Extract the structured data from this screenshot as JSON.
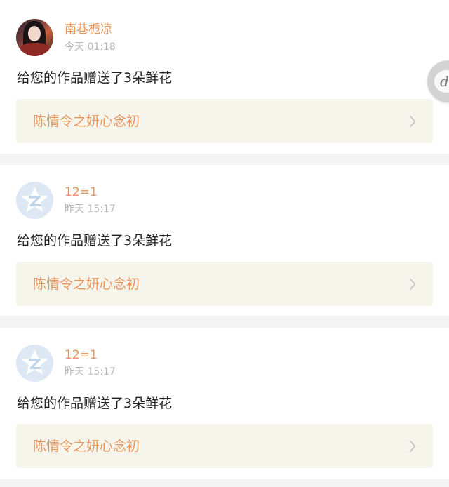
{
  "notifications": [
    {
      "username": "南巷栀凉",
      "timestamp": "今天 01:18",
      "message": "给您的作品赠送了3朵鲜花",
      "work_title": "陈情令之妍心念初",
      "avatar": "photo-avatar"
    },
    {
      "username": "12=1",
      "timestamp": "昨天 15:17",
      "message": "给您的作品赠送了3朵鲜花",
      "work_title": "陈情令之妍心念初",
      "avatar": "default-avatar"
    },
    {
      "username": "12=1",
      "timestamp": "昨天 15:17",
      "message": "给您的作品赠送了3朵鲜花",
      "work_title": "陈情令之妍心念初",
      "avatar": "default-avatar"
    }
  ],
  "floating_button": {
    "icon": "bear-face-icon",
    "glyph": "d"
  },
  "colors": {
    "accent": "#e8955c",
    "timestamp": "#b5b5b5",
    "link_background": "#f5f5ec",
    "separator": "#f4f4f4",
    "default_avatar_bg": "#dde8f4"
  }
}
